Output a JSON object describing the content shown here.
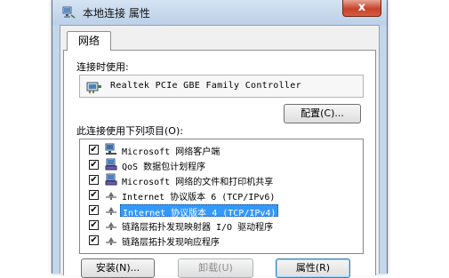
{
  "window": {
    "title": "本地连接 属性",
    "close_glyph": "x"
  },
  "tabs": [
    {
      "label": "网络",
      "active": true
    }
  ],
  "connection": {
    "label": "连接时使用:",
    "adapter_name": "Realtek PCIe GBE Family Controller",
    "adapter_icon": "network-adapter-icon",
    "configure_label": "配置(C)..."
  },
  "items_section": {
    "label": "此连接使用下列项目(O):",
    "items": [
      {
        "label": "Microsoft 网络客户端",
        "checked": true,
        "icon": "client-icon",
        "selected": false
      },
      {
        "label": "QoS 数据包计划程序",
        "checked": true,
        "icon": "service-icon",
        "selected": false
      },
      {
        "label": "Microsoft 网络的文件和打印机共享",
        "checked": true,
        "icon": "service-icon",
        "selected": false
      },
      {
        "label": "Internet 协议版本 6 (TCP/IPv6)",
        "checked": true,
        "icon": "protocol-icon",
        "selected": false
      },
      {
        "label": "Internet 协议版本 4 (TCP/IPv4)",
        "checked": true,
        "icon": "protocol-icon",
        "selected": true
      },
      {
        "label": "链路层拓扑发现映射器 I/O 驱动程序",
        "checked": true,
        "icon": "protocol-icon",
        "selected": false
      },
      {
        "label": "链路层拓扑发现响应程序",
        "checked": true,
        "icon": "protocol-icon",
        "selected": false
      }
    ]
  },
  "buttons": {
    "install": "安装(N)...",
    "uninstall": "卸载(U)",
    "properties": "属性(R)"
  },
  "check_glyph": "✔",
  "colors": {
    "selection": "#3399ff",
    "close_button": "#c7432a",
    "title_bar": "#c4d6ea"
  }
}
